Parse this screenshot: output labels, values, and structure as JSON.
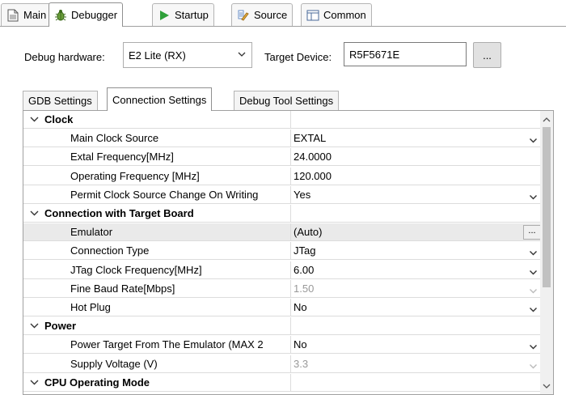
{
  "top_tabs": [
    {
      "label": "Main",
      "icon": "file-icon"
    },
    {
      "label": "Debugger",
      "icon": "bug-icon",
      "active": true
    },
    {
      "label": "Startup",
      "icon": "play-icon"
    },
    {
      "label": "Source",
      "icon": "source-icon"
    },
    {
      "label": "Common",
      "icon": "window-icon"
    }
  ],
  "hardware": {
    "label": "Debug hardware:",
    "value": "E2 Lite (RX)",
    "target_label": "Target Device:",
    "target_value": "R5F5671E",
    "browse_label": "..."
  },
  "inner_tabs": [
    {
      "label": "GDB Settings"
    },
    {
      "label": "Connection Settings",
      "active": true
    },
    {
      "label": "Debug Tool Settings"
    }
  ],
  "table": {
    "rows": [
      {
        "kind": "cat",
        "name": "Clock"
      },
      {
        "kind": "prop",
        "name": "Main Clock Source",
        "value": "EXTAL",
        "control": "dropdown"
      },
      {
        "kind": "prop",
        "name": "Extal Frequency[MHz]",
        "value": "24.0000"
      },
      {
        "kind": "prop",
        "name": "Operating Frequency [MHz]",
        "value": "120.000"
      },
      {
        "kind": "prop",
        "name": "Permit Clock Source Change On Writing",
        "value": "Yes",
        "control": "dropdown"
      },
      {
        "kind": "cat",
        "name": "Connection with Target Board"
      },
      {
        "kind": "prop",
        "name": "Emulator",
        "value": "(Auto)",
        "control": "ellipsis",
        "selected": true
      },
      {
        "kind": "prop",
        "name": "Connection Type",
        "value": "JTag",
        "control": "dropdown"
      },
      {
        "kind": "prop",
        "name": "JTag Clock Frequency[MHz]",
        "value": "6.00",
        "control": "dropdown"
      },
      {
        "kind": "prop",
        "name": "Fine Baud Rate[Mbps]",
        "value": "1.50",
        "control": "dropdown",
        "disabled": true
      },
      {
        "kind": "prop",
        "name": "Hot Plug",
        "value": "No",
        "control": "dropdown"
      },
      {
        "kind": "cat",
        "name": "Power"
      },
      {
        "kind": "prop",
        "name": "Power Target From The Emulator (MAX 2",
        "value": "No",
        "control": "dropdown"
      },
      {
        "kind": "prop",
        "name": "Supply Voltage (V)",
        "value": "3.3",
        "control": "dropdown",
        "disabled": true
      },
      {
        "kind": "cat",
        "name": "CPU Operating Mode"
      }
    ]
  }
}
